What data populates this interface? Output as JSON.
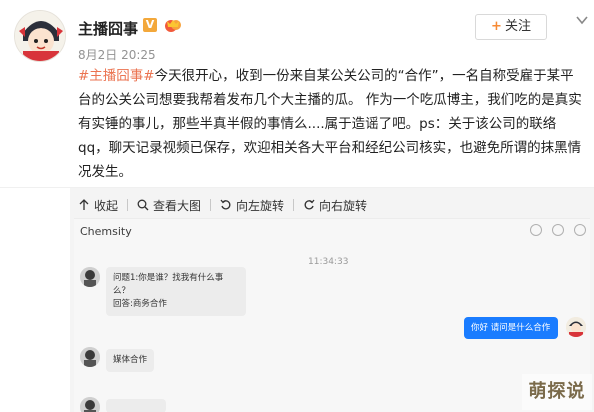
{
  "post": {
    "user_name": "主播囧事",
    "verified_badge": "V",
    "member_icon": "crown-icon",
    "time": "8月2日 20:25",
    "follow_label": "关注",
    "follow_plus": "+",
    "hashtag": "#主播囧事#",
    "text": "今天很开心，收到一份来自某公关公司的“合作”，一名自称受雇于某平台的公关公司想要我帮着发布几个大主播的瓜。 作为一个吃瓜博主，我们吃的是真实有实锤的事儿，那些半真半假的事情么....属于造谣了吧。ps：关于该公司的联络qq，聊天记录视频已保存，欢迎相关各大平台和经纪公司核实，也避免所谓的抹黑情况发生。"
  },
  "image_toolbar": {
    "collapse": "收起",
    "view_large": "查看大图",
    "rotate_left": "向左旋转",
    "rotate_right": "向右旋转"
  },
  "chat": {
    "title": "Chemsity",
    "timestamp": "11:34:33",
    "messages": [
      {
        "side": "left",
        "text": "问题1:你是谁？找我有什么事么？\n回答:商务合作"
      },
      {
        "side": "right",
        "text": "你好 请问是什么合作"
      },
      {
        "side": "left",
        "text": "媒体合作"
      }
    ]
  },
  "watermark": "萌探说",
  "colors": {
    "hashtag": "#eb7350",
    "badge": "#f3a83b",
    "bubble_right": "#1a7cff"
  }
}
